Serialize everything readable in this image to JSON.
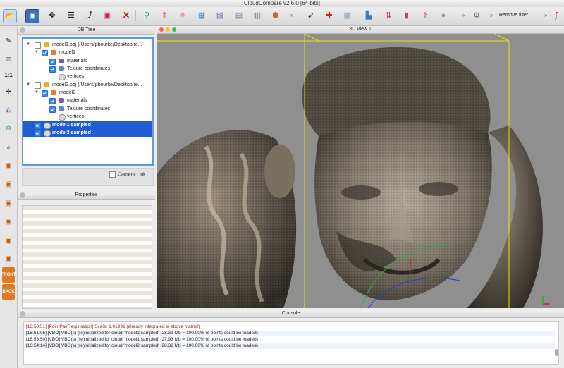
{
  "window": {
    "title": "CloudCompare v2.6.0 [64 bits]"
  },
  "toolbar": {
    "remove_filter_label": "Remove filter"
  },
  "left_toolbar": {
    "front_label": "FRONT",
    "back_label": "BACK",
    "ratio_label": "1:1"
  },
  "db_tree": {
    "title": "DB Tree",
    "rows": [
      {
        "label": "model1.obj (/Users/pbourke/Desktop/re...",
        "checked": false
      },
      {
        "label": "model1",
        "checked": true
      },
      {
        "label": "materials",
        "checked": true
      },
      {
        "label": "Texture coordinates",
        "checked": true
      },
      {
        "label": "vertices",
        "checked": false
      },
      {
        "label": "model2.obj (/Users/pbourke/Desktop/re...",
        "checked": false
      },
      {
        "label": "model2",
        "checked": true
      },
      {
        "label": "materials",
        "checked": true
      },
      {
        "label": "Texture coordinates",
        "checked": true
      },
      {
        "label": "vertices",
        "checked": false
      },
      {
        "label": "model1.sampled",
        "checked": true,
        "selected": true
      },
      {
        "label": "model2.sampled",
        "checked": true,
        "selected": true
      }
    ],
    "camera_link_label": "Camera Link"
  },
  "properties": {
    "title": "Properties"
  },
  "view3d": {
    "title": "3D View 1"
  },
  "console": {
    "title": "Console",
    "lines": [
      "[16:50:51] [PointPairRegistration] Scale: 1.01991 (already integrated in above matrix!)",
      "[16:51:05] [VBO] VBO(s) (re)initialized for cloud 'model2.sampled' (28.32 Mb = 100.00% of points could be loaded)",
      "[16:53:50] [VBO] VBO(s) (re)initialized for cloud 'model1.sampled' (27.93 Mb = 100.00% of points could be loaded)",
      "[16:54:14] [VBO] VBO(s) (re)initialized for cloud 'model2.sampled' (28.32 Mb = 100.00% of points could be loaded)"
    ]
  },
  "colors": {
    "selection": "#1f5cd0",
    "focus_border": "#5d9bdc",
    "bbox": "#e6e600",
    "error_text": "#b01818"
  },
  "icons": [
    "open-icon",
    "save-icon",
    "transform-icon",
    "list-icon",
    "clone-icon",
    "merge-icon",
    "delete-icon",
    "sample-icon",
    "normals-icon",
    "octree-icon",
    "scalar-field-icon",
    "color-icon",
    "filter-icon",
    "chevron-right-icon",
    "plugin-icon"
  ]
}
